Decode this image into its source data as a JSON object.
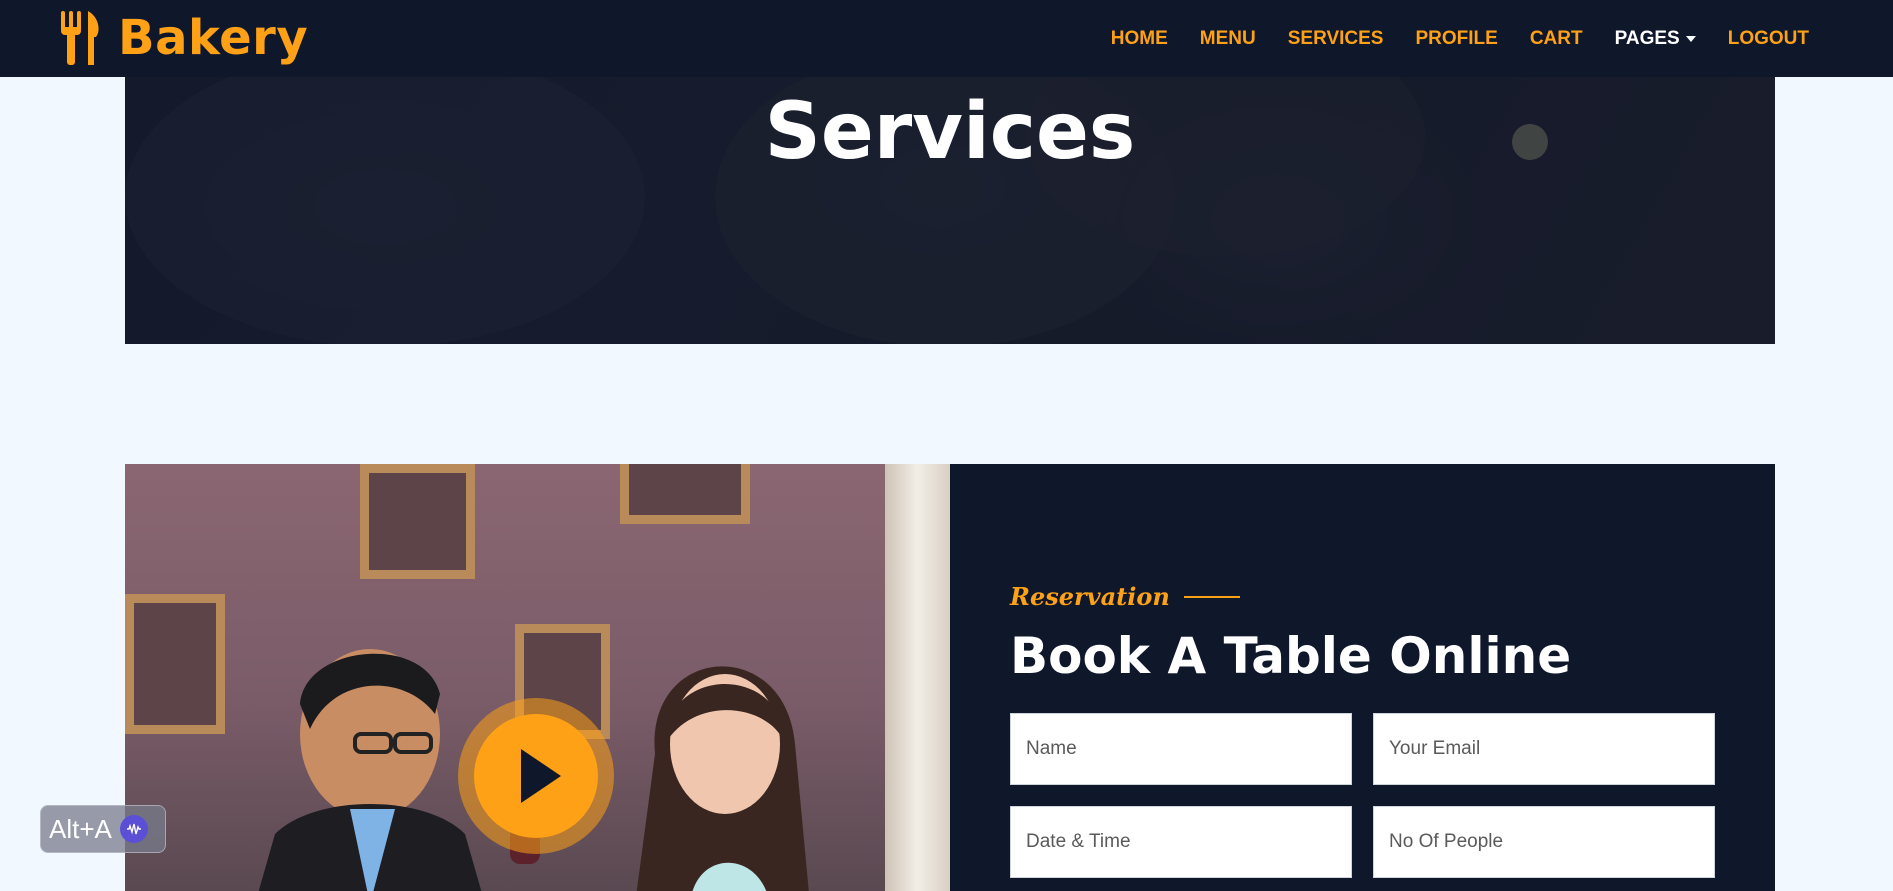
{
  "brand": {
    "name": "Bakery",
    "icon": "utensils-icon"
  },
  "nav": {
    "items": [
      {
        "label": "HOME"
      },
      {
        "label": "MENU"
      },
      {
        "label": "SERVICES"
      },
      {
        "label": "PROFILE"
      },
      {
        "label": "CART"
      },
      {
        "label": "PAGES"
      },
      {
        "label": "LOGOUT"
      }
    ]
  },
  "hero": {
    "title": "Services"
  },
  "video": {
    "play_icon": "play-icon"
  },
  "reservation": {
    "subtitle": "Reservation",
    "title": "Book A Table Online",
    "fields": {
      "name_placeholder": "Name",
      "email_placeholder": "Your Email",
      "datetime_placeholder": "Date & Time",
      "people_placeholder": "No Of People"
    }
  },
  "assistant_badge": {
    "label": "Alt+A",
    "icon": "waveform-icon"
  },
  "colors": {
    "primary": "#fea116",
    "dark": "#0f172b",
    "background": "#f1f8ff"
  }
}
